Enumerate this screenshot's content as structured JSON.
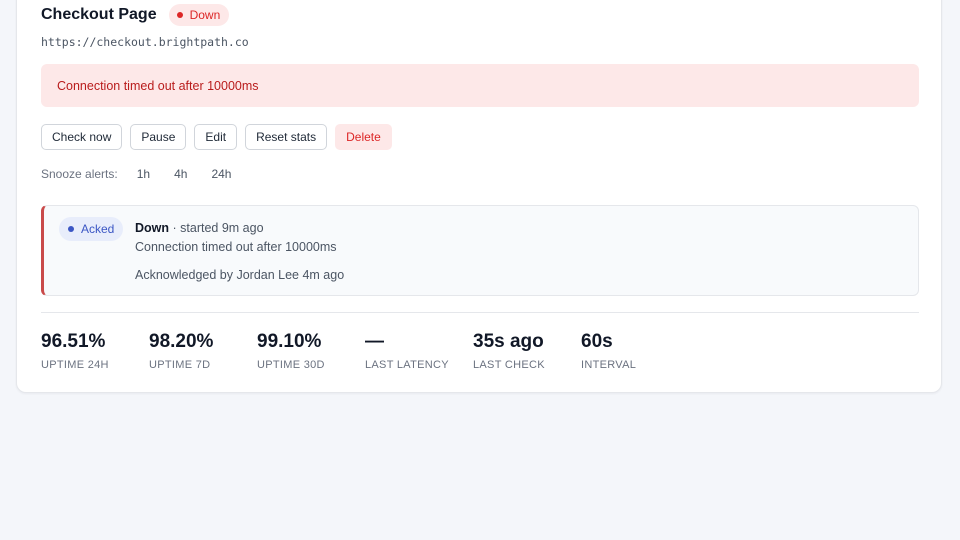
{
  "monitor": {
    "name": "Checkout Page",
    "status": "Down",
    "url": "https://checkout.brightpath.co",
    "error_message": "Connection timed out after 10000ms"
  },
  "actions": {
    "check_now": "Check now",
    "pause": "Pause",
    "edit": "Edit",
    "reset_stats": "Reset stats",
    "delete": "Delete"
  },
  "snooze": {
    "label": "Snooze alerts:",
    "options": [
      "1h",
      "4h",
      "24h"
    ]
  },
  "incident": {
    "badge": "Acked",
    "state": "Down",
    "started": "· started 9m ago",
    "message": "Connection timed out after 10000ms",
    "acknowledged": "Acknowledged by Jordan Lee 4m ago"
  },
  "stats": [
    {
      "value": "96.51%",
      "label": "Uptime 24h"
    },
    {
      "value": "98.20%",
      "label": "Uptime 7d"
    },
    {
      "value": "99.10%",
      "label": "Uptime 30d"
    },
    {
      "value": "—",
      "label": "Last latency"
    },
    {
      "value": "35s ago",
      "label": "Last check"
    },
    {
      "value": "60s",
      "label": "Interval"
    }
  ],
  "colors": {
    "down": "#dc2626",
    "down_bg": "#fde8e8",
    "acked": "#3b56c4",
    "acked_bg": "#e8edfb",
    "incident_border": "#c94a4a"
  }
}
